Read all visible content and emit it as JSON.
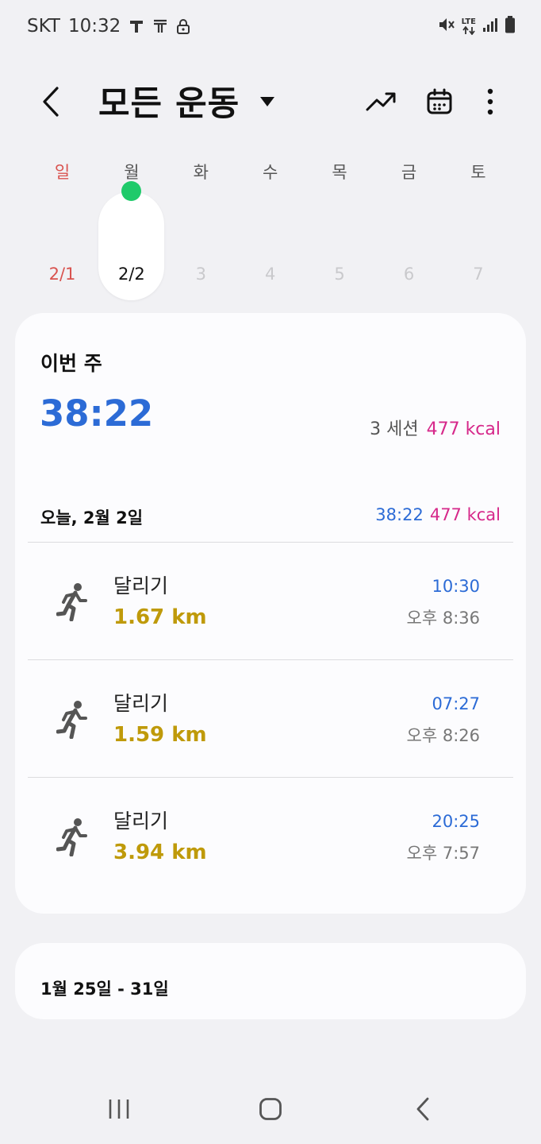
{
  "status_bar": {
    "carrier": "SKT",
    "time": "10:32",
    "icons": [
      "t-icon",
      "t-outline-icon",
      "lock-icon",
      "mute-icon",
      "lte-icon",
      "signal-icon",
      "battery-icon"
    ],
    "lte_label": "LTE"
  },
  "header": {
    "title": "모든 운동"
  },
  "week": {
    "days": [
      {
        "name": "일",
        "num": "2/1",
        "sunday": true,
        "selected": false,
        "has_workout": false
      },
      {
        "name": "월",
        "num": "2/2",
        "sunday": false,
        "selected": true,
        "has_workout": true
      },
      {
        "name": "화",
        "num": "3",
        "sunday": false,
        "selected": false,
        "has_workout": false
      },
      {
        "name": "수",
        "num": "4",
        "sunday": false,
        "selected": false,
        "has_workout": false
      },
      {
        "name": "목",
        "num": "5",
        "sunday": false,
        "selected": false,
        "has_workout": false
      },
      {
        "name": "금",
        "num": "6",
        "sunday": false,
        "selected": false,
        "has_workout": false
      },
      {
        "name": "토",
        "num": "7",
        "sunday": false,
        "selected": false,
        "has_workout": false
      }
    ]
  },
  "this_week": {
    "label": "이번 주",
    "duration": "38:22",
    "sessions": "3 세션",
    "kcal": "477 kcal"
  },
  "today": {
    "label": "오늘, 2월 2일",
    "duration": "38:22",
    "kcal": "477 kcal"
  },
  "workouts": [
    {
      "name": "달리기",
      "distance": "1.67 km",
      "duration": "10:30",
      "time": "오후 8:36"
    },
    {
      "name": "달리기",
      "distance": "1.59 km",
      "duration": "07:27",
      "time": "오후 8:26"
    },
    {
      "name": "달리기",
      "distance": "3.94 km",
      "duration": "20:25",
      "time": "오후 7:57"
    }
  ],
  "previous_week": {
    "label": "1월 25일 - 31일"
  },
  "colors": {
    "accent_blue": "#2c6bd6",
    "kcal_pink": "#d6288a",
    "distance_gold": "#bf9a0a",
    "sunday_red": "#d9534f",
    "workout_dot_green": "#1fca6a"
  }
}
